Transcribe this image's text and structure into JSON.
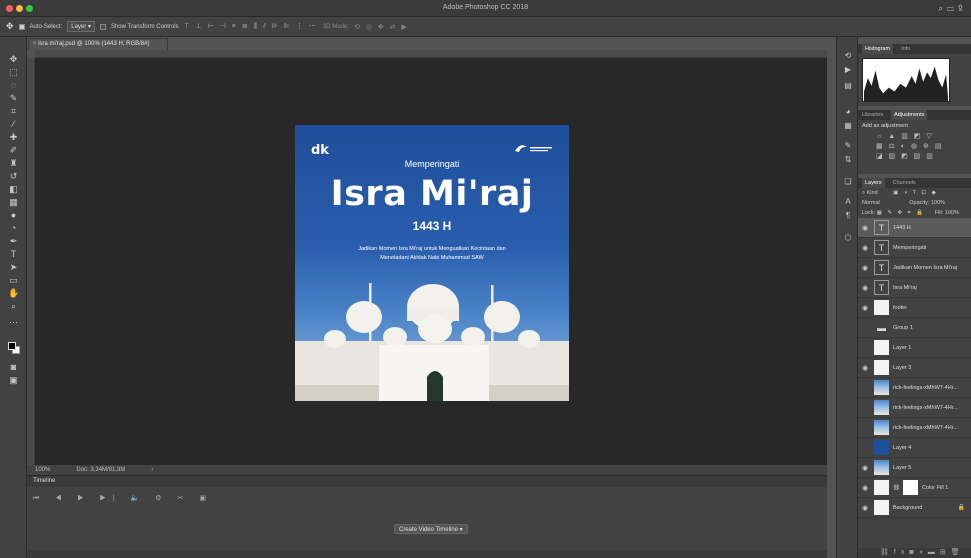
{
  "window": {
    "app_title": "Adobe Photoshop CC 2018",
    "traffic_lights": [
      "#fc605c",
      "#fdbc40",
      "#34c84a"
    ]
  },
  "options_bar": {
    "auto_select_label": "Auto-Select:",
    "auto_select_value": "Layer",
    "show_transform_label": "Show Transform Controls",
    "mode_3d_label": "3D Mode:"
  },
  "document": {
    "tab_label": "isra mi'raj.psd @ 100% (1443 H, RGB/8#)",
    "zoom": "100%",
    "doc_info": "Doc: 3,34M/81,9M"
  },
  "artwork": {
    "logo_left": "dk",
    "pre_title": "Memperingati",
    "title": "Isra Mi'raj",
    "year": "1443 H",
    "description_line1": "Jadikan Momen Isra Mi'raj untuk Menguatkan Kecintaan dan",
    "description_line2": "Meneladani Akhlak Nabi Muhammad SAW",
    "colors": {
      "sky_top": "#1f4e9a",
      "sky_bottom": "#9cc0e6",
      "mosque": "#f1efe9"
    }
  },
  "timeline": {
    "title": "Timeline",
    "create_button": "Create Video Timeline"
  },
  "histogram_panel": {
    "tabs": [
      "Histogram",
      "Info"
    ]
  },
  "adjustments_panel": {
    "tabs": [
      "Libraries",
      "Adjustments"
    ],
    "heading": "Add an adjustment"
  },
  "layers_panel": {
    "tabs": [
      "Layers",
      "Channels"
    ],
    "filter_kind": "Kind",
    "blend_mode": "Normal",
    "opacity_label": "Opacity:",
    "opacity_value": "100%",
    "lock_label": "Lock:",
    "fill_label": "Fill:",
    "fill_value": "100%",
    "layers": [
      {
        "name": "1443 H",
        "kind": "text",
        "visible": true,
        "selected": true
      },
      {
        "name": "Memperingati",
        "kind": "text",
        "visible": true
      },
      {
        "name": "Jadikan Momen Isra Mi'raj",
        "kind": "text",
        "visible": true
      },
      {
        "name": "Isra Mi'raj",
        "kind": "text",
        "visible": true
      },
      {
        "name": "footer",
        "kind": "smart",
        "visible": true
      },
      {
        "name": "Group 1",
        "kind": "group",
        "visible": false
      },
      {
        "name": "Layer 1",
        "kind": "white",
        "visible": false
      },
      {
        "name": "Layer 3",
        "kind": "white",
        "visible": true
      },
      {
        "name": "rick-feelings-xMhW7-4Hr...",
        "kind": "photo",
        "visible": false
      },
      {
        "name": "rick-feelings-xMhW7-4Hr...",
        "kind": "photo",
        "visible": false
      },
      {
        "name": "rick-feelings-xMhW7-4Hr...",
        "kind": "photo",
        "visible": false
      },
      {
        "name": "Layer 4",
        "kind": "blue",
        "visible": false
      },
      {
        "name": "Layer 5",
        "kind": "photo",
        "visible": true
      },
      {
        "name": "Color Fill 1",
        "kind": "fill",
        "visible": true
      },
      {
        "name": "Background",
        "kind": "white",
        "visible": true,
        "locked": true
      }
    ]
  }
}
